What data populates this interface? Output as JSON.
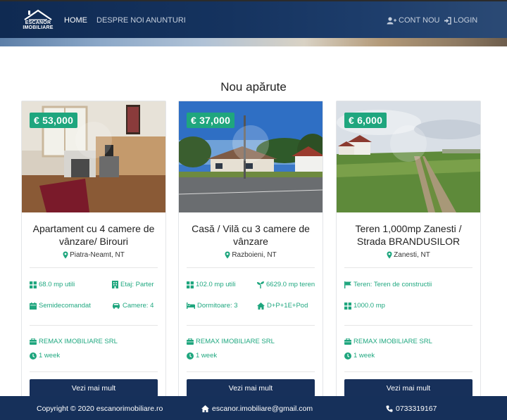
{
  "brand": {
    "logo_text_line1": "ESCANOR",
    "logo_text_line2": "IMOBILIARE"
  },
  "nav": {
    "home": "HOME",
    "about": "DESPRE NOI",
    "listings": "ANUNTURI",
    "register": "CONT NOU",
    "login": "LOGIN"
  },
  "section_title": "Nou apărute",
  "colors": {
    "navy": "#16305a",
    "accent_green": "#1fa67e"
  },
  "cards": [
    {
      "price": "€ 53,000",
      "title": "Apartament cu 4 camere de vânzare/ Birouri",
      "location": "Piatra-Neamt, NT",
      "features": [
        {
          "icon": "grid-icon",
          "text": "68.0 mp utili"
        },
        {
          "icon": "building-icon",
          "text": "Etaj: Parter"
        },
        {
          "icon": "calendar-icon",
          "text": "Semidecomandat"
        },
        {
          "icon": "car-icon",
          "text": "Camere: 4"
        }
      ],
      "agency": "REMAX IMOBILIARE SRL",
      "posted": "1 week",
      "button": "Vezi mai mult"
    },
    {
      "price": "€ 37,000",
      "title": "Casă / Vilă cu 3 camere de vânzare",
      "location": "Razboieni, NT",
      "features": [
        {
          "icon": "grid-icon",
          "text": "102.0 mp utili"
        },
        {
          "icon": "seedling-icon",
          "text": "6629.0 mp teren"
        },
        {
          "icon": "bed-icon",
          "text": "Dormitoare: 3"
        },
        {
          "icon": "home-icon",
          "text": "D+P+1E+Pod"
        }
      ],
      "agency": "REMAX IMOBILIARE SRL",
      "posted": "1 week",
      "button": "Vezi mai mult"
    },
    {
      "price": "€ 6,000",
      "title": "Teren 1,000mp Zanesti / Strada BRANDUSILOR",
      "location": "Zanesti, NT",
      "features": [
        {
          "icon": "flag-icon",
          "text": "Teren: Teren de constructii"
        },
        {
          "icon": "grid-icon",
          "text": "1000.0 mp"
        }
      ],
      "agency": "REMAX IMOBILIARE SRL",
      "posted": "1 week",
      "button": "Vezi mai mult"
    }
  ],
  "footer": {
    "copyright": "Copyright © 2020 escanorimobiliare.ro",
    "email": "escanor.imobiliare@gmail.com",
    "phone": "0733319167"
  }
}
